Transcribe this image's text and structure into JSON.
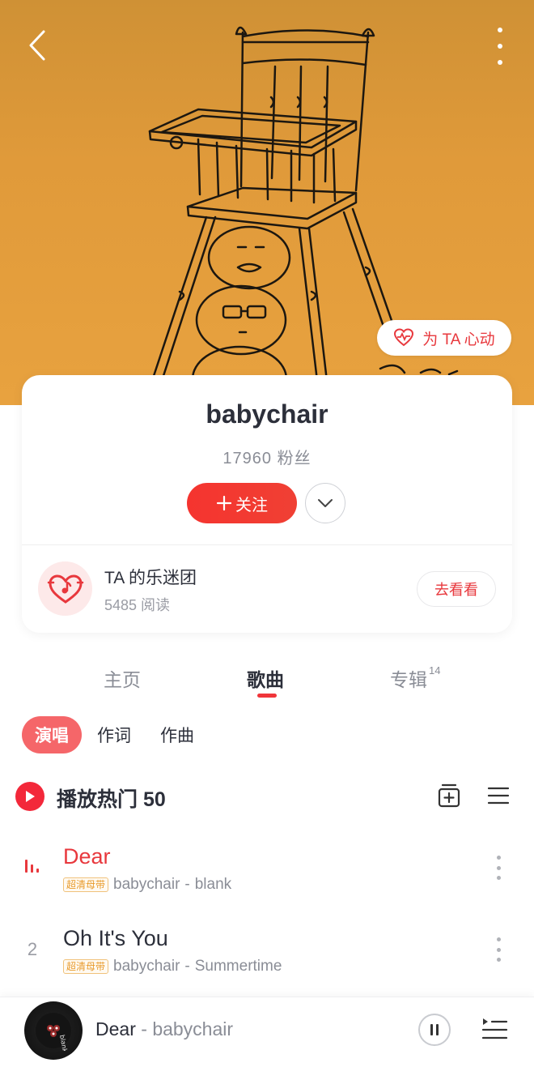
{
  "header": {
    "heart_button_label": "为 TA 心动"
  },
  "artist": {
    "name": "babychair",
    "fans_count": "17960",
    "fans_label": "粉丝",
    "follow_label": "关注"
  },
  "fan_club": {
    "title": "TA 的乐迷团",
    "reads": "5485 阅读",
    "visit_label": "去看看"
  },
  "tabs": [
    {
      "label": "主页",
      "active": false
    },
    {
      "label": "歌曲",
      "active": true
    },
    {
      "label": "专辑",
      "count": "14",
      "active": false
    }
  ],
  "filters": [
    {
      "label": "演唱",
      "active": true
    },
    {
      "label": "作词",
      "active": false
    },
    {
      "label": "作曲",
      "active": false
    }
  ],
  "play_all": {
    "label": "播放热门 50"
  },
  "songs": [
    {
      "index": "",
      "title": "Dear",
      "badge": "超清母带",
      "artist": "babychair",
      "album": "blank",
      "playing": true
    },
    {
      "index": "2",
      "title": "Oh It's You",
      "badge": "超清母带",
      "artist": "babychair",
      "album": "Summertime",
      "playing": false
    }
  ],
  "player": {
    "title": "Dear",
    "separator": "-",
    "artist": "babychair",
    "disc_text": "blank"
  },
  "colors": {
    "accent_red": "#f0353a",
    "banner_orange": "#e09a3a",
    "chip_active": "#f56669"
  },
  "icons": [
    "back-arrow-icon",
    "more-vertical-icon",
    "heart-ecg-icon",
    "plus-icon",
    "chevron-down-icon",
    "fan-club-heart-icon",
    "play-icon",
    "add-to-playlist-icon",
    "list-menu-icon",
    "equalizer-icon",
    "kebab-icon",
    "pause-icon",
    "playlist-queue-icon"
  ]
}
